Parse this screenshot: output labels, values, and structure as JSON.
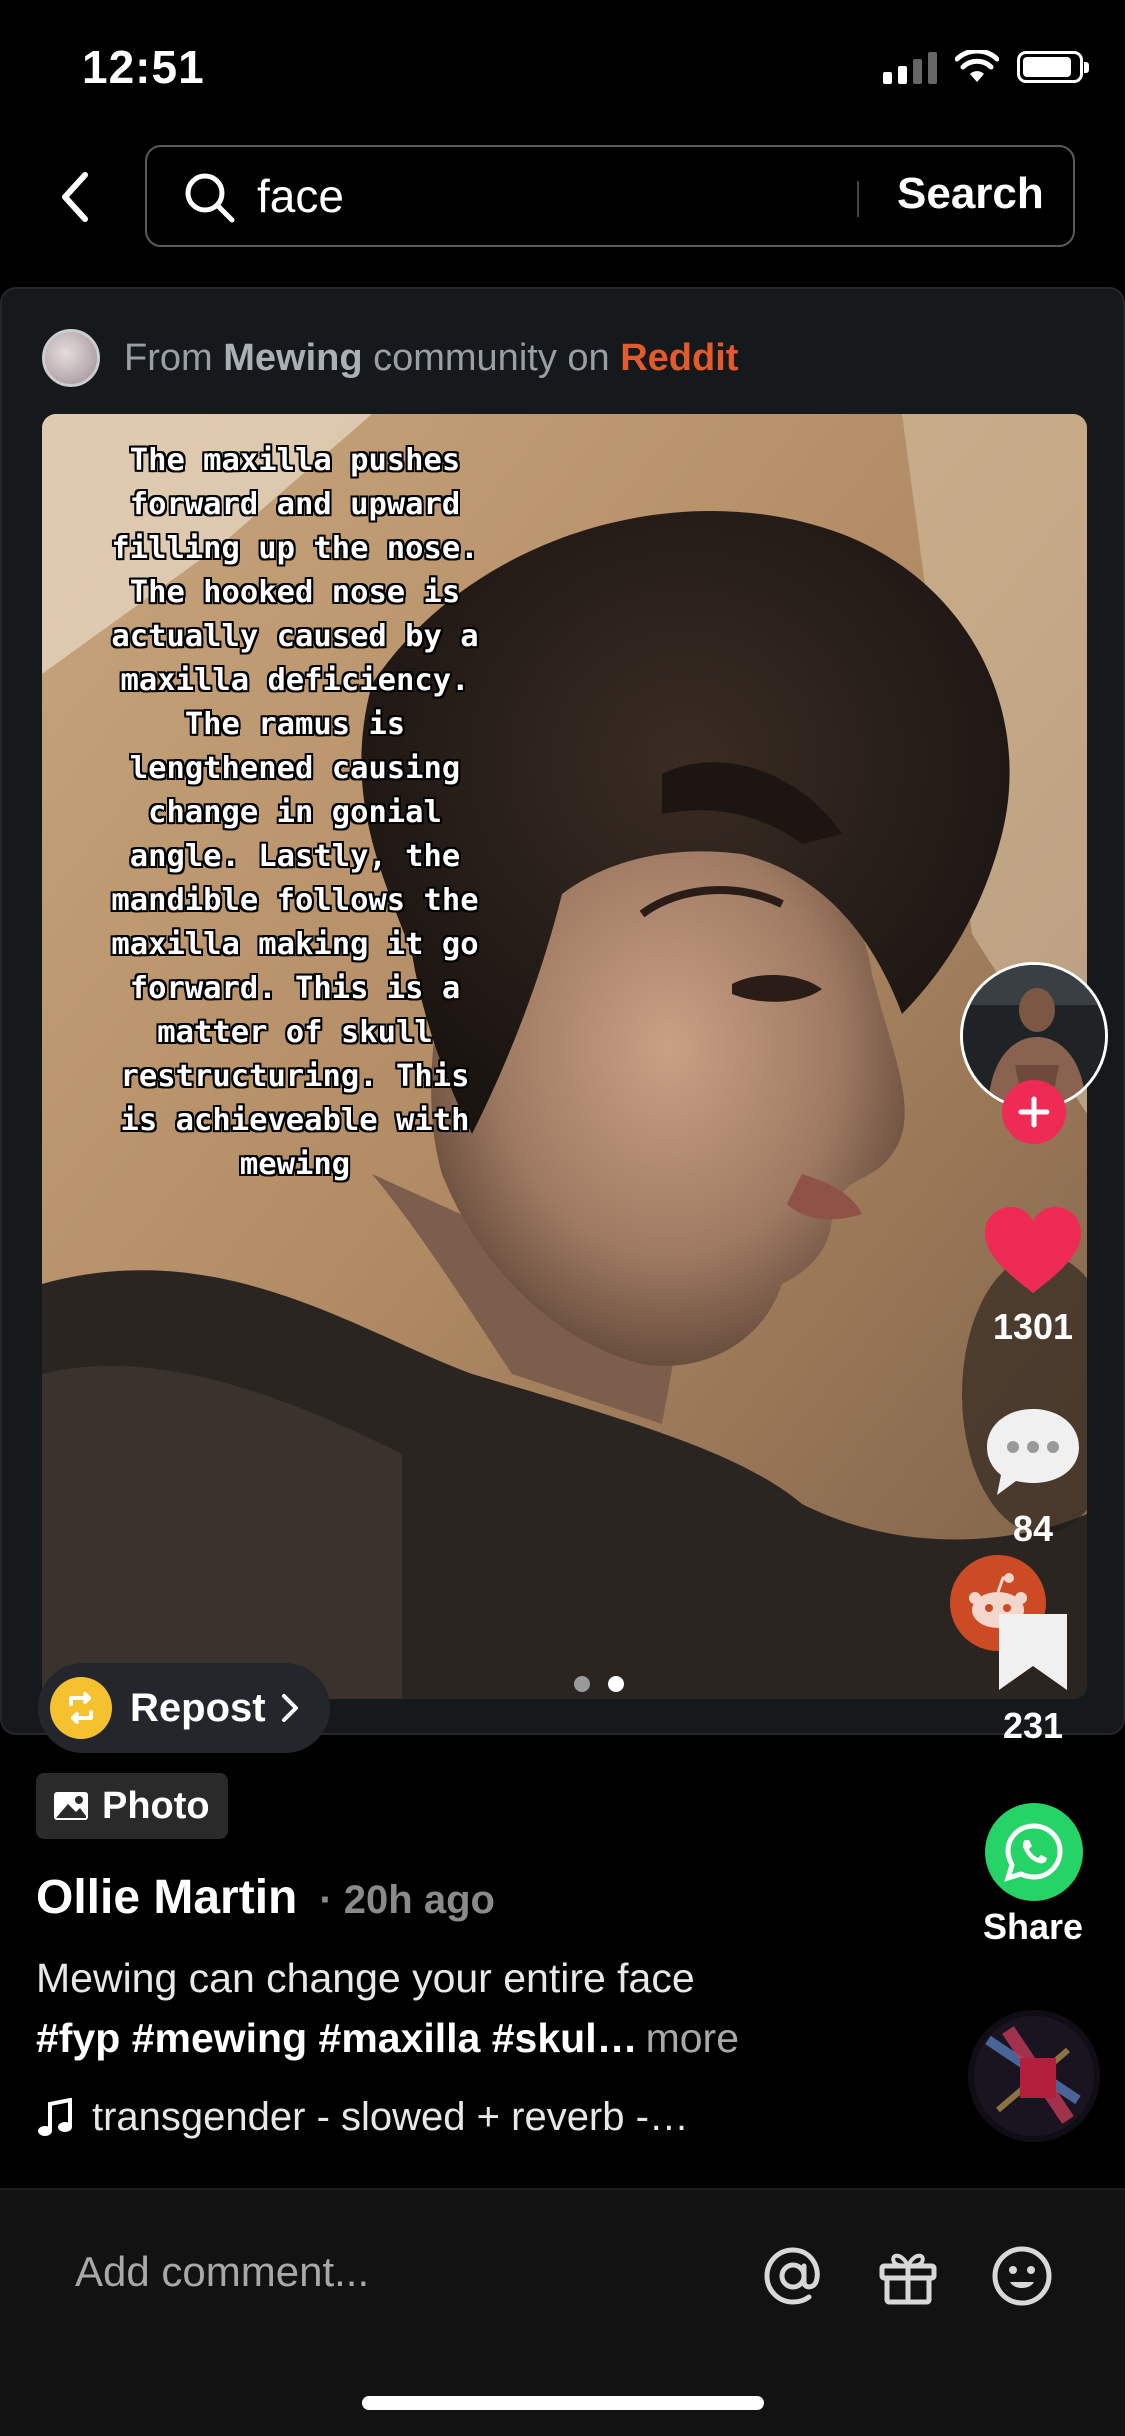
{
  "status_bar": {
    "time": "12:51"
  },
  "search": {
    "query": "face",
    "button_label": "Search"
  },
  "source": {
    "prefix": "From",
    "community": "Mewing",
    "middle": "community on",
    "platform": "Reddit"
  },
  "post": {
    "overlay_text": "The maxilla pushes\nforward and upward\nfilling up the nose.\nThe hooked nose is\nactually caused by a\nmaxilla deficiency.\nThe ramus is\nlengthened causing\nchange in gonial\nangle. Lastly, the\nmandible follows the\nmaxilla making it go\nforward. This is a\nmatter of skull\nrestructuring. This\nis achieveable with\nmewing",
    "page_dots": {
      "total": 2,
      "active": 2
    },
    "repost_label": "Repost",
    "type_label": "Photo",
    "author": "Ollie Martin",
    "time_ago": "· 20h ago",
    "caption": "Mewing can change your entire face",
    "hashtags": "#fyp #mewing #maxilla #skul…",
    "more_label": "more",
    "music": "transgender - slowed + reverb -…"
  },
  "actions": {
    "likes": "1301",
    "comments": "84",
    "saves": "231",
    "share_label": "Share"
  },
  "comment_bar": {
    "placeholder": "Add comment..."
  },
  "colors": {
    "like": "#ee2b54",
    "reddit": "#e35a2b",
    "whatsapp": "#25d366",
    "repost": "#f6c12e"
  }
}
